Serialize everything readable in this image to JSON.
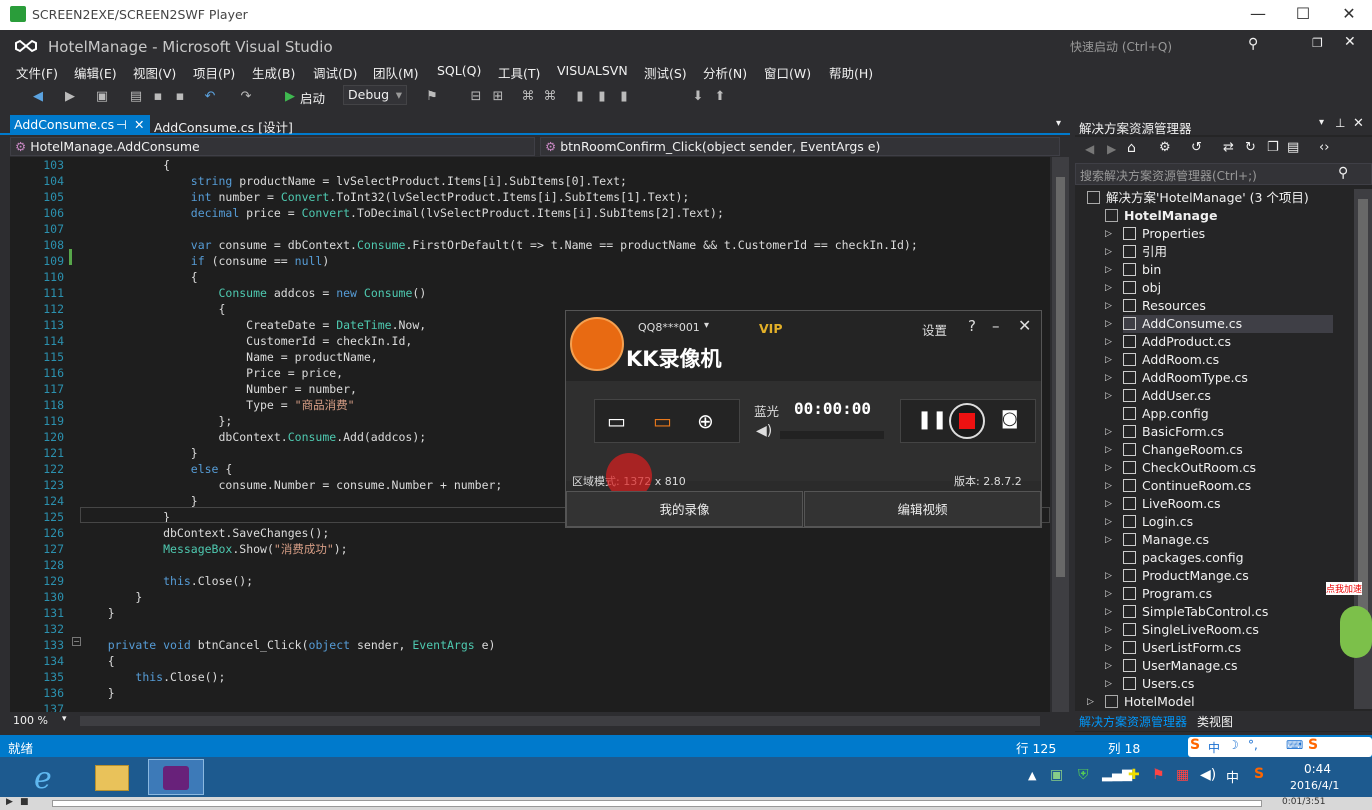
{
  "player": {
    "title": "SCREEN2EXE/SCREEN2SWF Player"
  },
  "vs": {
    "title": "HotelManage - Microsoft Visual Studio",
    "quick_launch": "快速启动 (Ctrl+Q)"
  },
  "menu": [
    "文件(F)",
    "编辑(E)",
    "视图(V)",
    "项目(P)",
    "生成(B)",
    "调试(D)",
    "团队(M)",
    "SQL(Q)",
    "工具(T)",
    "VISUALSVN",
    "测试(S)",
    "分析(N)",
    "窗口(W)",
    "帮助(H)"
  ],
  "toolbar": {
    "start": "启动",
    "config": "Debug"
  },
  "tabs": [
    {
      "label": "AddConsume.cs"
    },
    {
      "label": "AddConsume.cs [设计]"
    }
  ],
  "nav": {
    "class": "HotelManage.AddConsume",
    "method": "btnRoomConfirm_Click(object sender, EventArgs e)"
  },
  "code_lines": [
    {
      "n": "103",
      "t": "            {"
    },
    {
      "n": "104",
      "t": "                string productName = lvSelectProduct.Items[i].SubItems[0].Text;"
    },
    {
      "n": "105",
      "t": "                int number = Convert.ToInt32(lvSelectProduct.Items[i].SubItems[1].Text);"
    },
    {
      "n": "106",
      "t": "                decimal price = Convert.ToDecimal(lvSelectProduct.Items[i].SubItems[2].Text);"
    },
    {
      "n": "107",
      "t": ""
    },
    {
      "n": "108",
      "t": "                var consume = dbContext.Consume.FirstOrDefault(t => t.Name == productName && t.CustomerId == checkIn.Id);"
    },
    {
      "n": "109",
      "t": "                if (consume == null)"
    },
    {
      "n": "110",
      "t": "                {"
    },
    {
      "n": "111",
      "t": "                    Consume addcos = new Consume()"
    },
    {
      "n": "112",
      "t": "                    {"
    },
    {
      "n": "113",
      "t": "                        CreateDate = DateTime.Now,"
    },
    {
      "n": "114",
      "t": "                        CustomerId = checkIn.Id,"
    },
    {
      "n": "115",
      "t": "                        Name = productName,"
    },
    {
      "n": "116",
      "t": "                        Price = price,"
    },
    {
      "n": "117",
      "t": "                        Number = number,"
    },
    {
      "n": "118",
      "t": "                        Type = \"商品消费\""
    },
    {
      "n": "119",
      "t": "                    };"
    },
    {
      "n": "120",
      "t": "                    dbContext.Consume.Add(addcos);"
    },
    {
      "n": "121",
      "t": "                }"
    },
    {
      "n": "122",
      "t": "                else {"
    },
    {
      "n": "123",
      "t": "                    consume.Number = consume.Number + number;"
    },
    {
      "n": "124",
      "t": "                }"
    },
    {
      "n": "125",
      "t": "            }"
    },
    {
      "n": "126",
      "t": "            dbContext.SaveChanges();"
    },
    {
      "n": "127",
      "t": "            MessageBox.Show(\"消费成功\");"
    },
    {
      "n": "128",
      "t": ""
    },
    {
      "n": "129",
      "t": "            this.Close();"
    },
    {
      "n": "130",
      "t": "        }"
    },
    {
      "n": "131",
      "t": "    }"
    },
    {
      "n": "132",
      "t": ""
    },
    {
      "n": "133",
      "t": "    private void btnCancel_Click(object sender, EventArgs e)"
    },
    {
      "n": "134",
      "t": "    {"
    },
    {
      "n": "135",
      "t": "        this.Close();"
    },
    {
      "n": "136",
      "t": "    }"
    },
    {
      "n": "137",
      "t": ""
    }
  ],
  "zoom": "100 %",
  "solution_explorer": {
    "title": "解决方案资源管理器",
    "search_placeholder": "搜索解决方案资源管理器(Ctrl+;)",
    "solution": "解决方案'HotelManage' (3 个项目)",
    "project": "HotelManage",
    "items": [
      "Properties",
      "引用",
      "bin",
      "obj",
      "Resources",
      "AddConsume.cs",
      "AddProduct.cs",
      "AddRoom.cs",
      "AddRoomType.cs",
      "AddUser.cs",
      "App.config",
      "BasicForm.cs",
      "ChangeRoom.cs",
      "CheckOutRoom.cs",
      "ContinueRoom.cs",
      "LiveRoom.cs",
      "Login.cs",
      "Manage.cs",
      "packages.config",
      "ProductMange.cs",
      "Program.cs",
      "SimpleTabControl.cs",
      "SingleLiveRoom.cs",
      "UserListForm.cs",
      "UserManage.cs",
      "Users.cs"
    ],
    "next_project": "HotelModel",
    "bottom_tabs": [
      "解决方案资源管理器",
      "类视图"
    ]
  },
  "status": {
    "ready": "就绪",
    "line": "行 125",
    "col": "列 18"
  },
  "kk": {
    "account": "QQ8***001",
    "vip": "VIP",
    "settings": "设置",
    "brand": "KK录像机",
    "quality": "蓝光",
    "timer": "00:00:00",
    "region": "区域模式: 1372 x 810",
    "version": "版本: 2.8.7.2",
    "my_recordings": "我的录像",
    "edit_video": "编辑视频"
  },
  "tray": {
    "time": "0:44",
    "date": "2016/4/1",
    "ime": "中",
    "badge": "点我加速"
  },
  "player_progress": "0:01/3:51"
}
